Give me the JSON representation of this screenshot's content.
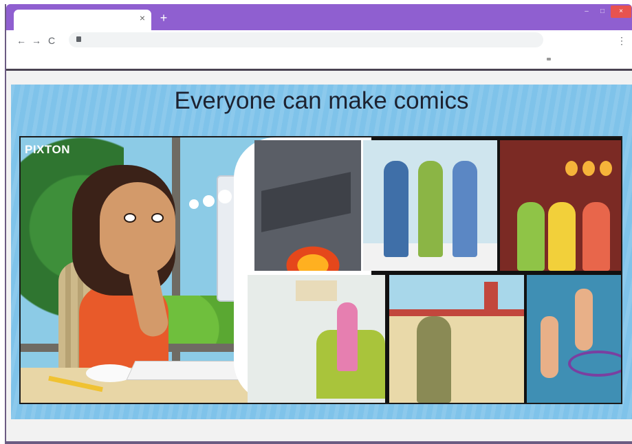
{
  "browser": {
    "new_tab_symbol": "+",
    "tab_close_symbol": "×",
    "window_controls": {
      "minimize": "–",
      "maximize": "□",
      "close": "×"
    },
    "nav": {
      "back": "←",
      "forward": "→",
      "reload": "C",
      "menu": "⋮"
    },
    "icons": [
      "arrow-left-icon",
      "arrow-right-icon",
      "reload-icon",
      "lock-icon",
      "kebab-menu-icon"
    ],
    "accent_color": "#8f5fd0"
  },
  "slide": {
    "headline": "Everyone can make comics",
    "brand": "PIXTON",
    "background_color": "#7fc3ea"
  }
}
